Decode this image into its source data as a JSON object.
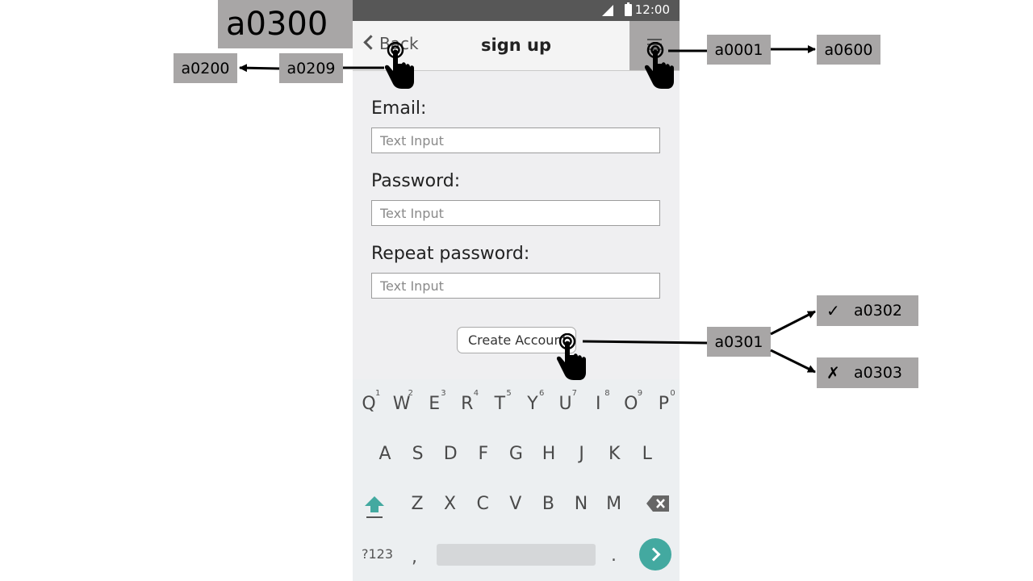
{
  "annotations": {
    "screen_id": "a0300",
    "back_target": "a0200",
    "back_action": "a0209",
    "menu_action": "a0001",
    "menu_target": "a0600",
    "create_action": "a0301",
    "success_target": "a0302",
    "fail_target": "a0303",
    "success_mark": "✓",
    "fail_mark": "✗"
  },
  "status_bar": {
    "time": "12:00"
  },
  "app_bar": {
    "back_label": "Back",
    "title": "sign up"
  },
  "form": {
    "email_label": "Email:",
    "email_placeholder": "Text Input",
    "password_label": "Password:",
    "password_placeholder": "Text Input",
    "repeat_label": "Repeat password:",
    "repeat_placeholder": "Text Input",
    "create_button": "Create Account"
  },
  "keyboard": {
    "row1": [
      "Q",
      "W",
      "E",
      "R",
      "T",
      "Y",
      "U",
      "I",
      "O",
      "P"
    ],
    "row1_hints": [
      "1",
      "2",
      "3",
      "4",
      "5",
      "6",
      "7",
      "8",
      "9",
      "0"
    ],
    "row2": [
      "A",
      "S",
      "D",
      "F",
      "G",
      "H",
      "J",
      "K",
      "L"
    ],
    "row3": [
      "Z",
      "X",
      "C",
      "V",
      "B",
      "N",
      "M"
    ],
    "symbols_key": "?123",
    "comma_key": ",",
    "period_key": ".",
    "accent_color": "#43a9a0"
  }
}
